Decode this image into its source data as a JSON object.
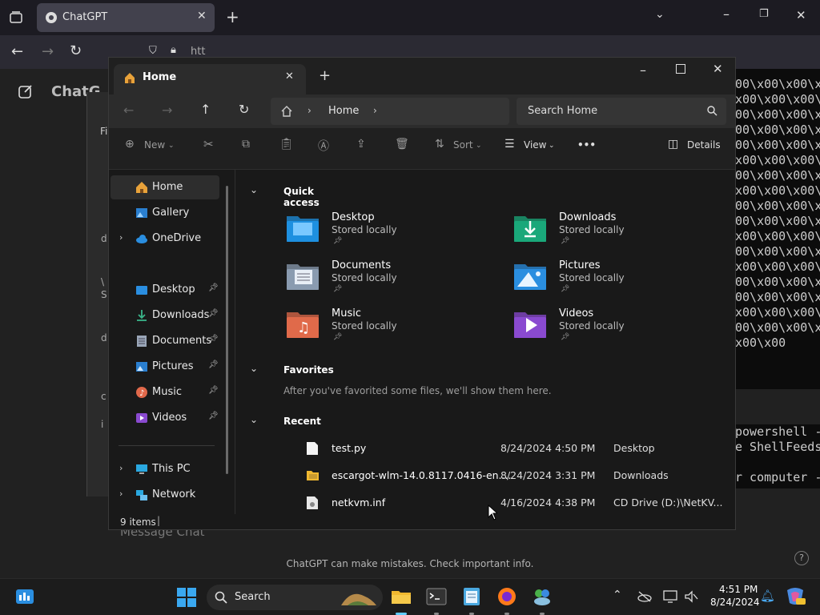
{
  "browser": {
    "tab_title": "ChatGPT",
    "address_partial": "htt",
    "sidebar_title": "ChatG"
  },
  "chat": {
    "message_placeholder": "Message Chat",
    "disclaimer": "ChatGPT can make mistakes. Check important info.",
    "help_icon": "?"
  },
  "terminal": {
    "lines": [
      "00\\x00\\x00\\x0",
      "x00\\x00\\x00\\",
      "00\\x00\\x00\\x0",
      "00\\x00\\x00\\x0",
      "00\\x00\\x00\\x0",
      "x00\\x00\\x00\\",
      "00\\x00\\x00\\x0",
      "x00\\x00\\x00\\",
      "00\\x00\\x00\\x0",
      "00\\x00\\x00\\x0",
      "x00\\x00\\x00\\",
      "00\\x00\\x00\\x0",
      "x00\\x00\\x00\\",
      "00\\x00\\x00\\x0",
      "00\\x00\\x00\\x0",
      "x00\\x00\\x00\\",
      "00\\x00\\x00\\x0",
      "x00\\x00"
    ],
    "lines2": [
      "powershell -",
      "e ShellFeeds",
      "",
      "r computer -"
    ]
  },
  "explorer": {
    "tab_title": "Home",
    "address_crumb": "Home",
    "search_placeholder": "Search Home",
    "toolbar": {
      "new_label": "New",
      "sort_label": "Sort",
      "view_label": "View",
      "more_label": "•••",
      "details_label": "Details"
    },
    "sidebar": {
      "home": "Home",
      "gallery": "Gallery",
      "onedrive": "OneDrive",
      "desktop": "Desktop",
      "downloads": "Downloads",
      "documents": "Documents",
      "pictures": "Pictures",
      "music": "Music",
      "videos": "Videos",
      "thispc": "This PC",
      "network": "Network"
    },
    "sections": {
      "quick_access": "Quick access",
      "favorites": "Favorites",
      "favorites_empty": "After you've favorited some files, we'll show them here.",
      "recent": "Recent"
    },
    "quick_access": [
      {
        "name": "Desktop",
        "status": "Stored locally",
        "color": "#1e90e0"
      },
      {
        "name": "Downloads",
        "status": "Stored locally",
        "color": "#1aa87a"
      },
      {
        "name": "Documents",
        "status": "Stored locally",
        "color": "#8a9bb0"
      },
      {
        "name": "Pictures",
        "status": "Stored locally",
        "color": "#2a8ee0"
      },
      {
        "name": "Music",
        "status": "Stored locally",
        "color": "#e06a4a"
      },
      {
        "name": "Videos",
        "status": "Stored locally",
        "color": "#8a4ad0"
      }
    ],
    "recent": [
      {
        "name": "test.py",
        "date": "8/24/2024 4:50 PM",
        "location": "Desktop"
      },
      {
        "name": "escargot-wlm-14.0.8117.0416-en....",
        "date": "8/24/2024 3:31 PM",
        "location": "Downloads"
      },
      {
        "name": "netkvm.inf",
        "date": "4/16/2024 4:38 PM",
        "location": "CD Drive (D:)\\NetKV..."
      }
    ],
    "status_items": "9 items"
  },
  "taskbar": {
    "search_label": "Search",
    "time": "4:51 PM",
    "date": "8/24/2024"
  }
}
